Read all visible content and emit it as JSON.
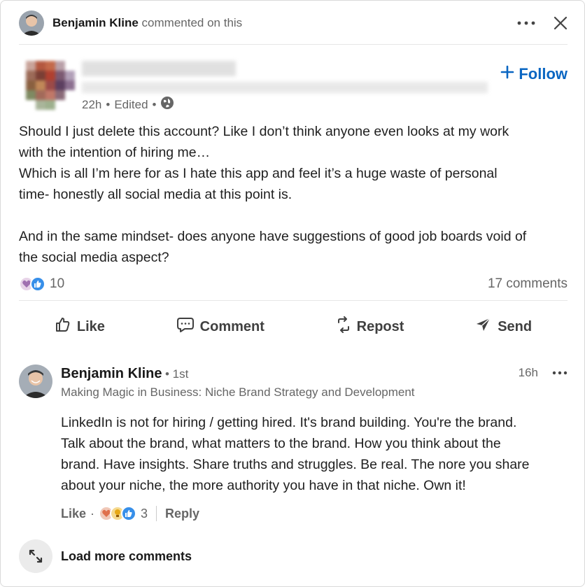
{
  "header": {
    "commenter_name": "Benjamin Kline",
    "action_text": "commented on this"
  },
  "post": {
    "meta_time": "22h",
    "meta_edited": "Edited",
    "follow_label": "Follow",
    "body_lines": [
      "Should I just delete this account? Like I don’t think anyone even looks at my work",
      "with the intention of hiring me…",
      "Which is all I’m here for as I hate this app and feel it’s a huge waste of personal",
      "time- honestly all social media at this point is."
    ],
    "body_lines_2": [
      "And in the same mindset- does anyone have suggestions of good job boards void of",
      "the social media aspect?"
    ],
    "reaction_count": "10",
    "comments_count": "17 comments"
  },
  "actions": {
    "like": "Like",
    "comment": "Comment",
    "repost": "Repost",
    "send": "Send"
  },
  "comment": {
    "author": "Benjamin Kline",
    "degree": "• 1st",
    "headline": "Making Magic in Business: Niche Brand Strategy and Development",
    "time": "16h",
    "text_lines": [
      "LinkedIn is not for hiring / getting hired. It's brand building. You're the brand.",
      "Talk about the brand, what matters to the brand. How you think about the",
      "brand. Have insights. Share truths and struggles. Be real. The nore you share",
      "about your niche, the more authority you have in that niche. Own it!"
    ],
    "like_label": "Like",
    "dot": "·",
    "reaction_count": "3",
    "reply_label": "Reply"
  },
  "load_more": {
    "label": "Load more comments"
  },
  "colors": {
    "accent": "#0a66c2",
    "muted": "#666666"
  }
}
